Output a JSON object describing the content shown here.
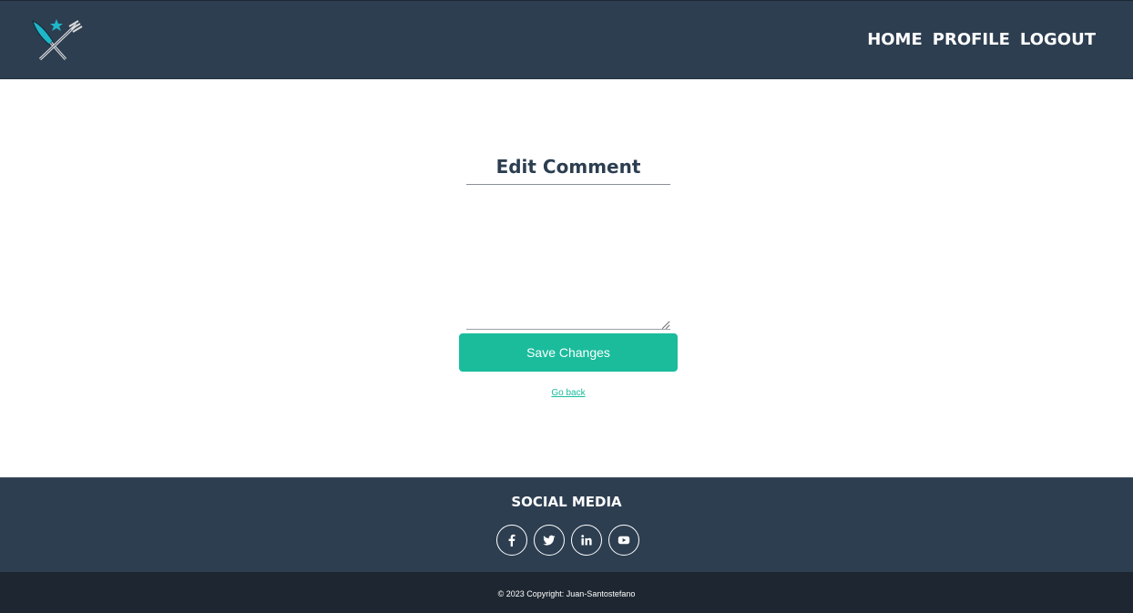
{
  "header": {
    "logo": "crossed-knife-fork-logo",
    "nav": {
      "home": "HOME",
      "profile": "PROFILE",
      "logout": "LOGOUT"
    }
  },
  "main": {
    "title": "Edit Comment",
    "comment_value": "",
    "save_label": "Save Changes",
    "back_label": "Go back"
  },
  "footer": {
    "social_title": "SOCIAL MEDIA",
    "icons": [
      "facebook-icon",
      "twitter-icon",
      "linkedin-icon",
      "youtube-icon"
    ],
    "copyright": "© 2023 Copyright: Juan-Santostefano"
  },
  "colors": {
    "header_bg": "#2d3e51",
    "accent": "#1abc9c",
    "footer_bottom_bg": "#1e2731"
  }
}
